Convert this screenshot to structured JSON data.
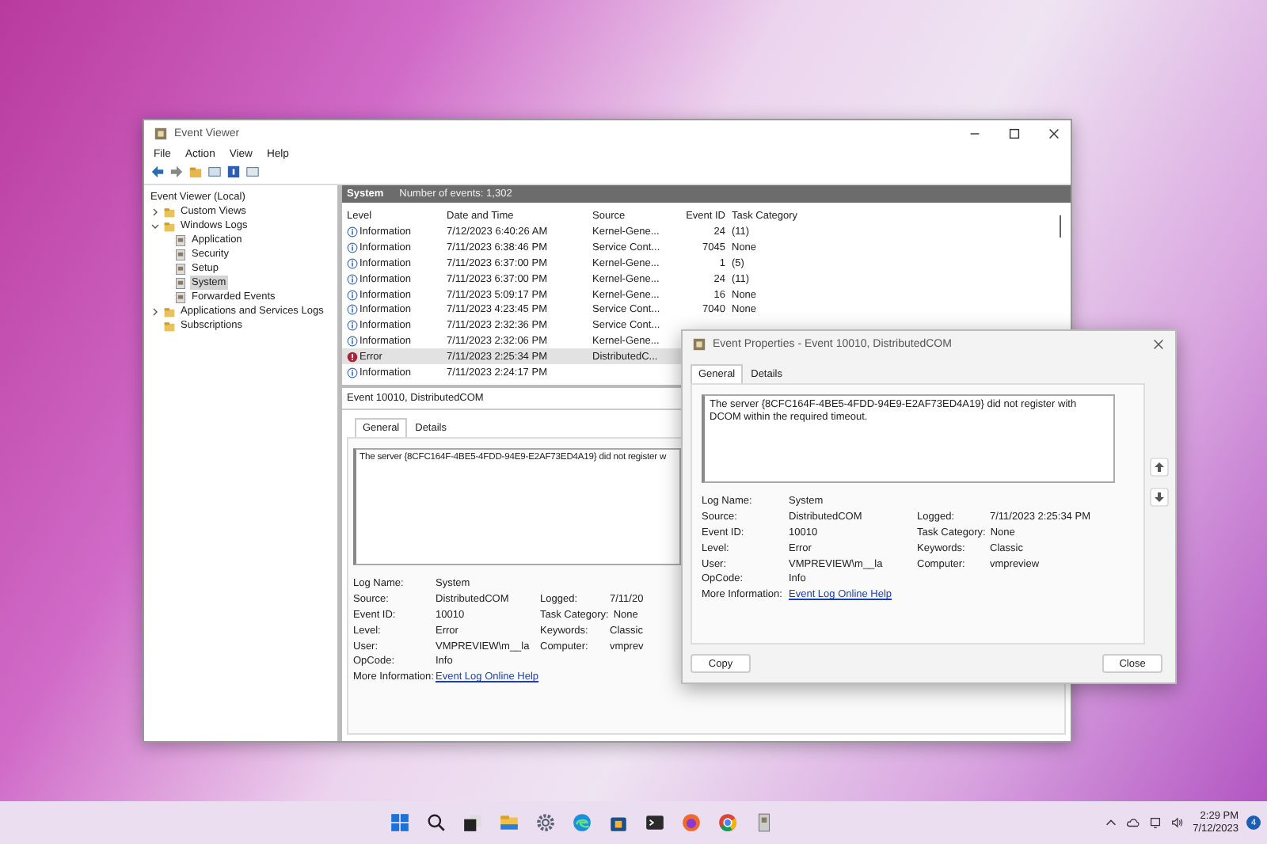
{
  "window": {
    "title": "Event Viewer"
  },
  "menu": [
    "File",
    "Action",
    "View",
    "Help"
  ],
  "tree": [
    {
      "label": "Event Viewer (Local)",
      "selected": false,
      "children": [
        {
          "label": "Custom Views",
          "expanded": false,
          "selected": false
        },
        {
          "label": "Windows Logs",
          "expanded": true,
          "selected": false,
          "children": [
            {
              "label": "Application",
              "selected": false
            },
            {
              "label": "Security",
              "selected": false
            },
            {
              "label": "Setup",
              "selected": false
            },
            {
              "label": "System",
              "selected": true
            },
            {
              "label": "Forwarded Events",
              "selected": false
            }
          ]
        },
        {
          "label": "Applications and Services Logs",
          "expanded": false,
          "selected": false
        },
        {
          "label": "Subscriptions",
          "selected": false
        }
      ]
    }
  ],
  "log_header": {
    "name": "System",
    "count": "Number of events: 1,302"
  },
  "events": {
    "columns": [
      "Level",
      "Date and Time",
      "Source",
      "Event ID",
      "Task Category"
    ],
    "rows": [
      {
        "kind": "information",
        "level": "Information",
        "date": "7/12/2023 6:40:26 AM",
        "source": "Kernel-Gene...",
        "event_id": "24",
        "category": "(11)",
        "selected": false
      },
      {
        "kind": "information",
        "level": "Information",
        "date": "7/11/2023 6:38:46 PM",
        "source": "Service Cont...",
        "event_id": "7045",
        "category": "None",
        "selected": false
      },
      {
        "kind": "information",
        "level": "Information",
        "date": "7/11/2023 6:37:00 PM",
        "source": "Kernel-Gene...",
        "event_id": "1",
        "category": "(5)",
        "selected": false
      },
      {
        "kind": "information",
        "level": "Information",
        "date": "7/11/2023 6:37:00 PM",
        "source": "Kernel-Gene...",
        "event_id": "24",
        "category": "(11)",
        "selected": false
      },
      {
        "kind": "information",
        "level": "Information",
        "date": "7/11/2023 5:09:17 PM",
        "source": "Kernel-Gene...",
        "event_id": "16",
        "category": "None",
        "selected": false
      },
      {
        "kind": "information",
        "level": "Information",
        "date": "7/11/2023 4:23:45 PM",
        "source": "Service Cont...",
        "event_id": "7040",
        "category": "None",
        "selected": false
      },
      {
        "kind": "information",
        "level": "Information",
        "date": "7/11/2023 2:32:36 PM",
        "source": "Service Cont...",
        "selected": false
      },
      {
        "kind": "information",
        "level": "Information",
        "date": "7/11/2023 2:32:06 PM",
        "source": "Kernel-Gene...",
        "selected": false
      },
      {
        "kind": "error",
        "level": "Error",
        "date": "7/11/2023 2:25:34 PM",
        "source": "DistributedC...",
        "selected": true
      },
      {
        "kind": "information",
        "level": "Information",
        "date": "7/11/2023 2:24:17 PM",
        "selected": false
      }
    ]
  },
  "preview": {
    "title": "Event 10010, DistributedCOM",
    "tabs": [
      {
        "label": "General",
        "selected": true
      },
      {
        "label": "Details",
        "selected": false
      }
    ],
    "message": "The server {8CFC164F-4BE5-4FDD-94E9-E2AF73ED4A19} did not register w",
    "fields": [
      {
        "label": "Log Name:",
        "value": "System"
      },
      {
        "label": "Source:",
        "value": "DistributedCOM",
        "label2": "Logged:",
        "value2": "7/11/20"
      },
      {
        "label": "Event ID:",
        "value": "10010",
        "label2": "Task Category:",
        "value2": "None"
      },
      {
        "label": "Level:",
        "value": "Error",
        "label2": "Keywords:",
        "value2": "Classic"
      },
      {
        "label": "User:",
        "value": "VMPREVIEW\\m__la",
        "label2": "Computer:",
        "value2": "vmprev"
      },
      {
        "label": "OpCode:",
        "value": "Info"
      }
    ],
    "more_label": "More Information:",
    "link": "Event Log Online Help"
  },
  "dialog": {
    "title": "Event Properties - Event 10010, DistributedCOM",
    "tabs": [
      {
        "label": "General",
        "selected": true
      },
      {
        "label": "Details",
        "selected": false
      }
    ],
    "message": "The server {8CFC164F-4BE5-4FDD-94E9-E2AF73ED4A19} did not register with DCOM within the required timeout.",
    "fields": [
      {
        "label": "Log Name:",
        "value": "System"
      },
      {
        "label": "Source:",
        "value": "DistributedCOM",
        "label2": "Logged:",
        "value2": "7/11/2023 2:25:34 PM"
      },
      {
        "label": "Event ID:",
        "value": "10010",
        "label2": "Task Category:",
        "value2": "None"
      },
      {
        "label": "Level:",
        "value": "Error",
        "label2": "Keywords:",
        "value2": "Classic"
      },
      {
        "label": "User:",
        "value": "VMPREVIEW\\m__la",
        "label2": "Computer:",
        "value2": "vmpreview"
      },
      {
        "label": "OpCode:",
        "value": "Info"
      }
    ],
    "more_label": "More Information:",
    "link": "Event Log Online Help",
    "buttons": [
      "Copy",
      "Close"
    ]
  },
  "taskbar": {
    "time": "2:29 PM",
    "date": "7/12/2023",
    "notifications": "4"
  }
}
